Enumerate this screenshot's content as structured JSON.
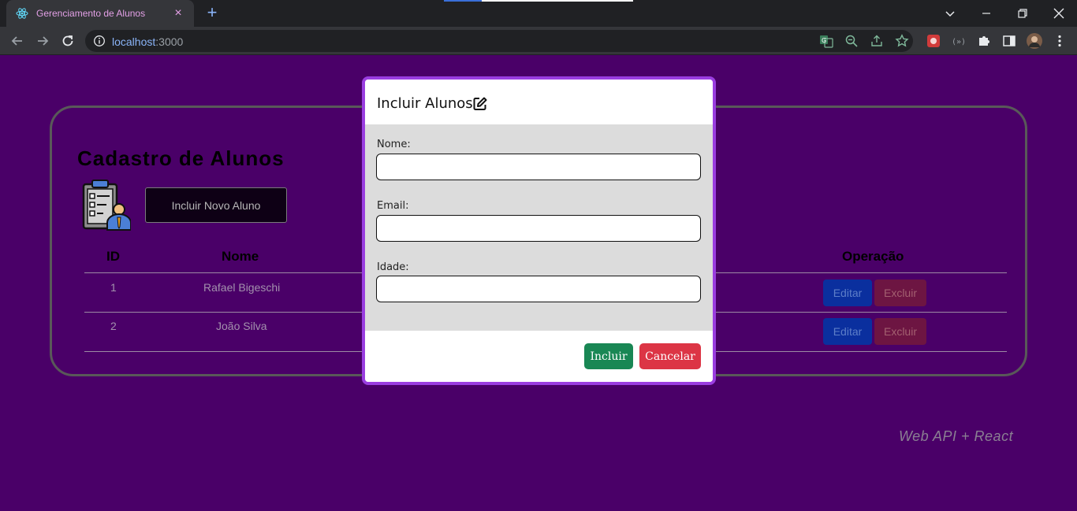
{
  "browser": {
    "tab_title": "Gerenciamento de Alunos",
    "url_host": "localhost",
    "url_port": ":3000"
  },
  "page": {
    "title": "Cadastro de Alunos",
    "new_student_label": "Incluir Novo Aluno",
    "columns": [
      "ID",
      "Nome",
      "Operação"
    ],
    "rows": [
      {
        "id": "1",
        "nome": "Rafael Bigeschi",
        "edit": "Editar",
        "delete": "Excluir"
      },
      {
        "id": "2",
        "nome": "João Silva",
        "edit": "Editar",
        "delete": "Excluir"
      }
    ],
    "footer": "Web API + React"
  },
  "modal": {
    "title": "Incluir Alunos",
    "fields": [
      {
        "label": "Nome:",
        "value": ""
      },
      {
        "label": "Email:",
        "value": ""
      },
      {
        "label": "Idade:",
        "value": ""
      }
    ],
    "include_label": "Incluir",
    "cancel_label": "Cancelar"
  },
  "colors": {
    "page_bg": "#4a0068",
    "modal_border": "#9a3de0",
    "include_btn": "#198754",
    "cancel_btn": "#dc3545"
  },
  "icons": {
    "favicon": "react-icon",
    "modal_title": "edit-icon",
    "student": "clipboard-person-icon"
  }
}
